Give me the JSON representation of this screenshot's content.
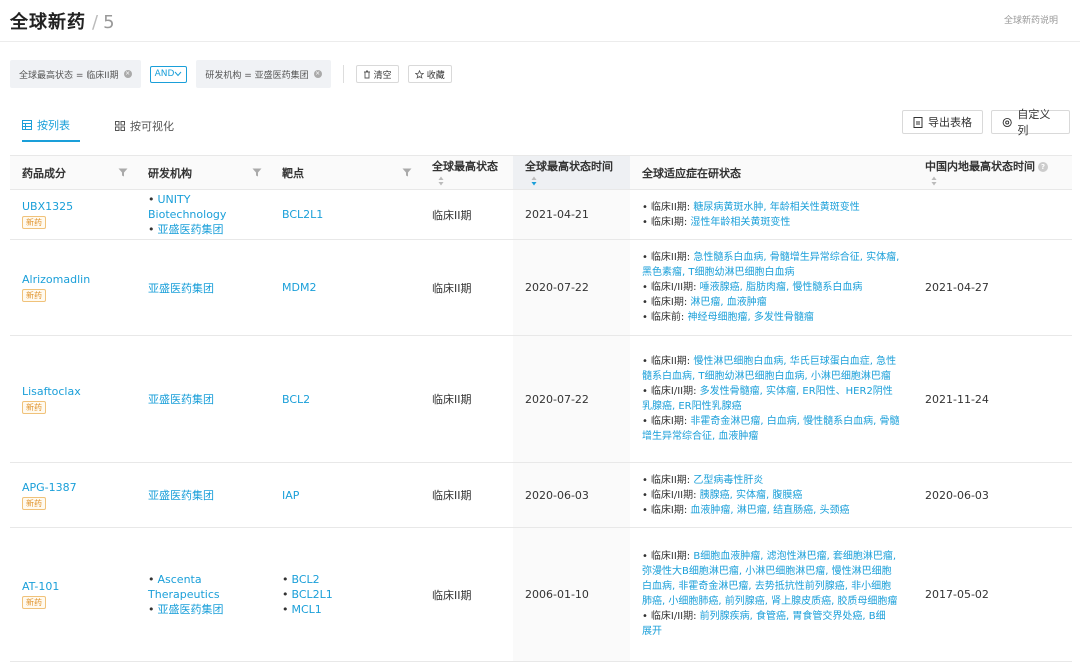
{
  "header": {
    "title": "全球新药",
    "count": "5",
    "help": "全球新药说明"
  },
  "filters": {
    "chip1": "全球最高状态 = 临床II期",
    "logic": "AND",
    "chip2": "研发机构 = 亚盛医药集团",
    "clear": "清空",
    "save": "收藏"
  },
  "tabs": {
    "list": "按列表",
    "visual": "按可视化"
  },
  "toolbar": {
    "export": "导出表格",
    "custom": "自定义列"
  },
  "table": {
    "headers": [
      "药品成分",
      "研发机构",
      "靶点",
      "全球最高状态",
      "全球最高状态时间",
      "全球适应症在研状态",
      "中国内地最高状态时间"
    ],
    "new_tag": "新药",
    "expand": "展开",
    "rows": [
      {
        "drug": "UBX1325",
        "orgs": [
          "UNITY Biotechnology",
          "亚盛医药集团"
        ],
        "targets": [
          "BCL2L1"
        ],
        "status": "临床II期",
        "date": "2021-04-21",
        "indications": [
          {
            "stage": "临床II期:",
            "diseases": "糖尿病黄斑水肿, 年龄相关性黄斑变性"
          },
          {
            "stage": "临床I期:",
            "diseases": "湿性年龄相关黄斑变性"
          }
        ],
        "cn_date": ""
      },
      {
        "drug": "Alrizomadlin",
        "orgs": [
          "亚盛医药集团"
        ],
        "targets": [
          "MDM2"
        ],
        "status": "临床II期",
        "date": "2020-07-22",
        "indications": [
          {
            "stage": "临床II期:",
            "diseases": "急性髓系白血病, 骨髓增生异常综合征, 实体瘤, 黑色素瘤, T细胞幼淋巴细胞白血病"
          },
          {
            "stage": "临床I/II期:",
            "diseases": "唾液腺癌, 脂肪肉瘤, 慢性髓系白血病"
          },
          {
            "stage": "临床I期:",
            "diseases": "淋巴瘤, 血液肿瘤"
          },
          {
            "stage": "临床前:",
            "diseases": "神经母细胞瘤, 多发性骨髓瘤"
          }
        ],
        "cn_date": "2021-04-27"
      },
      {
        "drug": "Lisaftoclax",
        "orgs": [
          "亚盛医药集团"
        ],
        "targets": [
          "BCL2"
        ],
        "status": "临床II期",
        "date": "2020-07-22",
        "indications": [
          {
            "stage": "临床II期:",
            "diseases": "慢性淋巴细胞白血病, 华氏巨球蛋白血症, 急性髓系白血病, T细胞幼淋巴细胞白血病, 小淋巴细胞淋巴瘤"
          },
          {
            "stage": "临床I/II期:",
            "diseases": "多发性骨髓瘤, 实体瘤, ER阳性、HER2阴性乳腺癌, ER阳性乳腺癌"
          },
          {
            "stage": "临床I期:",
            "diseases": "非霍奇金淋巴瘤, 白血病, 慢性髓系白血病, 骨髓增生异常综合征, 血液肿瘤"
          }
        ],
        "cn_date": "2021-11-24"
      },
      {
        "drug": "APG-1387",
        "orgs": [
          "亚盛医药集团"
        ],
        "targets": [
          "IAP"
        ],
        "status": "临床II期",
        "date": "2020-06-03",
        "indications": [
          {
            "stage": "临床II期:",
            "diseases": "乙型病毒性肝炎"
          },
          {
            "stage": "临床I/II期:",
            "diseases": "胰腺癌, 实体瘤, 腹膜癌"
          },
          {
            "stage": "临床I期:",
            "diseases": "血液肿瘤, 淋巴瘤, 结直肠癌, 头颈癌"
          }
        ],
        "cn_date": "2020-06-03"
      },
      {
        "drug": "AT-101",
        "orgs": [
          "Ascenta Therapeutics",
          "亚盛医药集团"
        ],
        "targets": [
          "BCL2",
          "BCL2L1",
          "MCL1"
        ],
        "status": "临床II期",
        "date": "2006-01-10",
        "indications": [
          {
            "stage": "临床II期:",
            "diseases": "B细胞血液肿瘤, 滤泡性淋巴瘤, 套细胞淋巴瘤, 弥漫性大B细胞淋巴瘤, 小淋巴细胞淋巴瘤, 慢性淋巴细胞白血病, 非霍奇金淋巴瘤, 去势抵抗性前列腺癌, 非小细胞肺癌, 小细胞肺癌, 前列腺癌, 肾上腺皮质癌, 胶质母细胞瘤"
          },
          {
            "stage": "临床I/II期:",
            "diseases": "前列腺疾病, 食管癌, 胃食管交界处癌, B细"
          }
        ],
        "cn_date": "2017-05-02"
      }
    ]
  }
}
